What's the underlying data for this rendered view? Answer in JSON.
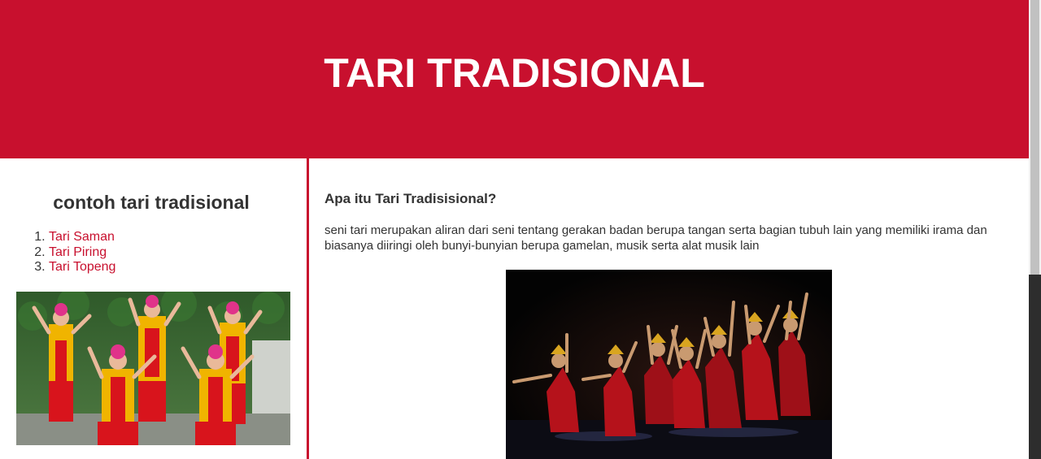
{
  "header": {
    "title": "TARI TRADISIONAL",
    "background_color": "#c8102e"
  },
  "sidebar": {
    "heading": "contoh tari tradisional",
    "items": [
      {
        "label": "Tari Saman"
      },
      {
        "label": "Tari Piring"
      },
      {
        "label": "Tari Topeng"
      }
    ],
    "link_color": "#c8102e",
    "photo": {
      "description": "group of dancers in red and yellow costumes",
      "colors": {
        "foliage": "#3f6b33",
        "costume_red": "#d8141c",
        "costume_yellow": "#f0b400"
      }
    }
  },
  "main": {
    "heading": "Apa itu Tari Tradisisional?",
    "paragraph": "seni tari merupakan aliran dari seni tentang gerakan badan berupa tangan serta bagian tubuh lain yang memiliki irama dan biasanya diiringi oleh bunyi-bunyian berupa gamelan, musik serta alat musik lain",
    "photo": {
      "description": "dancers performing on dark stage",
      "colors": {
        "stage": "#050505",
        "costume_red": "#b5121b",
        "gold": "#d9a520"
      }
    }
  },
  "accent_color": "#c8102e"
}
